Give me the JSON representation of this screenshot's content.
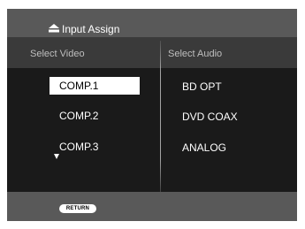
{
  "window": {
    "title": "Input Assign",
    "title_icon": "input-eject-icon"
  },
  "video": {
    "header": "Select Video",
    "selected_index": 0,
    "items": [
      "COMP.1",
      "COMP.2",
      "COMP.3"
    ],
    "more_indicator": "scroll-down-arrow-icon"
  },
  "audio": {
    "header": "Select Audio",
    "items": [
      "BD OPT",
      "DVD COAX",
      "ANALOG"
    ]
  },
  "footer": {
    "return_label": "RETURN"
  },
  "colors": {
    "background": "#1a1a1a",
    "bars": "#595959",
    "header_band": "#3a3a3a",
    "highlight": "#ffffff",
    "text": "#ffffff",
    "header_text": "#bfbfbf"
  }
}
